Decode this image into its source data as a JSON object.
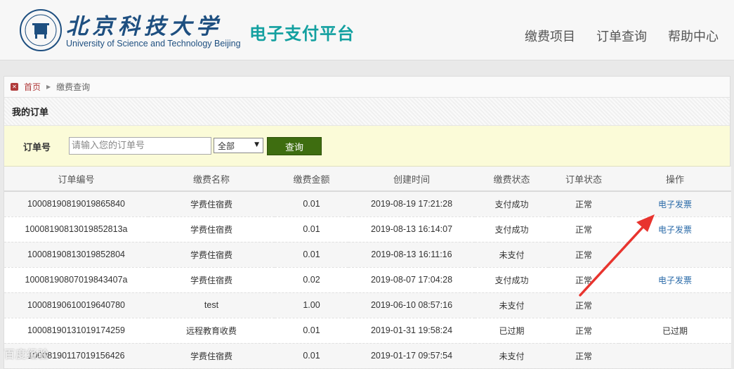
{
  "header": {
    "logo_cn": "北京科技大学",
    "logo_en": "University of Science and Technology Beijing",
    "platform_title": "电子支付平台",
    "nav": [
      "缴费项目",
      "订单查询",
      "帮助中心"
    ]
  },
  "breadcrumb": {
    "home": "首页",
    "current": "缴费查询"
  },
  "section_title": "我的订单",
  "search": {
    "label": "订单号",
    "placeholder": "请输入您的订单号",
    "select_value": "全部",
    "button": "查询"
  },
  "table": {
    "headers": [
      "订单编号",
      "缴费名称",
      "缴费金额",
      "创建时间",
      "缴费状态",
      "订单状态",
      "操作"
    ],
    "rows": [
      [
        "10008190819019865840",
        "学费住宿费",
        "0.01",
        "2019-08-19 17:21:28",
        "支付成功",
        "正常",
        "电子发票"
      ],
      [
        "10008190813019852813a",
        "学费住宿费",
        "0.01",
        "2019-08-13 16:14:07",
        "支付成功",
        "正常",
        "电子发票"
      ],
      [
        "10008190813019852804",
        "学费住宿费",
        "0.01",
        "2019-08-13 16:11:16",
        "未支付",
        "正常",
        ""
      ],
      [
        "10008190807019843407a",
        "学费住宿费",
        "0.02",
        "2019-08-07 17:04:28",
        "支付成功",
        "正常",
        "电子发票"
      ],
      [
        "10008190610019640780",
        "test",
        "1.00",
        "2019-06-10 08:57:16",
        "未支付",
        "正常",
        ""
      ],
      [
        "10008190131019174259",
        "远程教育收费",
        "0.01",
        "2019-01-31 19:58:24",
        "已过期",
        "正常",
        "已过期"
      ],
      [
        "10008190117019156426",
        "学费住宿费",
        "0.01",
        "2019-01-17 09:57:54",
        "未支付",
        "正常",
        ""
      ]
    ]
  },
  "colors": {
    "brand_blue": "#1e4f80",
    "platform_teal": "#13a0a0",
    "query_button": "#3e6d10",
    "link": "#2a6aa8",
    "annotation_arrow": "#e8342e"
  },
  "watermark": "百度经验"
}
